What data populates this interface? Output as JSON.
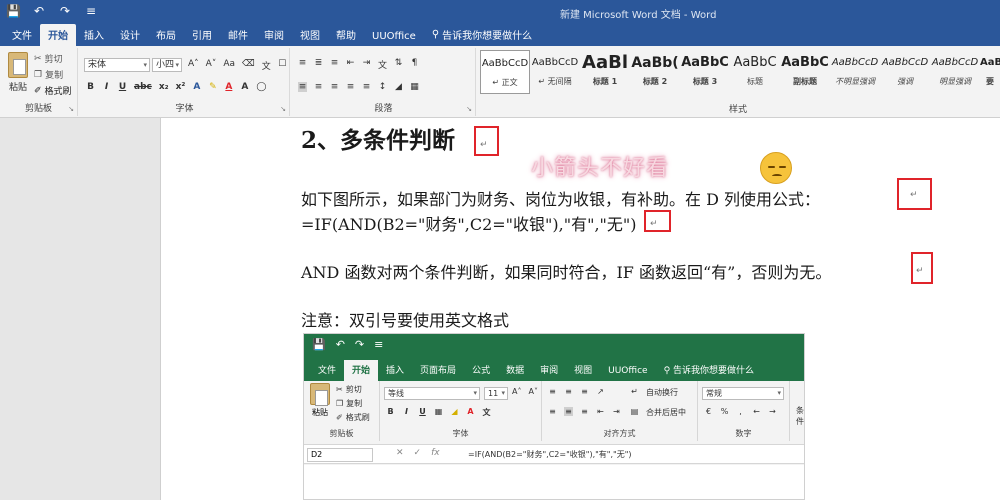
{
  "word": {
    "window_title": "新建 Microsoft Word 文档 - Word",
    "qat_icons": [
      "save-icon",
      "undo-icon",
      "redo-icon",
      "customize-icon"
    ],
    "tabs": [
      {
        "label": "文件"
      },
      {
        "label": "开始",
        "active": true
      },
      {
        "label": "插入"
      },
      {
        "label": "设计"
      },
      {
        "label": "布局"
      },
      {
        "label": "引用"
      },
      {
        "label": "邮件"
      },
      {
        "label": "审阅"
      },
      {
        "label": "视图"
      },
      {
        "label": "帮助"
      },
      {
        "label": "UUOffice"
      }
    ],
    "tell_me": "告诉我你想要做什么",
    "clipboard": {
      "paste": "粘贴",
      "cut": "剪切",
      "copy": "复制",
      "format_painter": "格式刷",
      "group": "剪贴板"
    },
    "font": {
      "name": "宋体",
      "size": "小四",
      "group": "字体"
    },
    "paragraph": {
      "group": "段落"
    },
    "styles": {
      "group": "样式",
      "items": [
        {
          "preview": "AaBbCcD",
          "name": "↵ 正文"
        },
        {
          "preview": "AaBbCcD",
          "name": "↵ 无间隔"
        },
        {
          "preview": "AaBl",
          "name": "标题 1"
        },
        {
          "preview": "AaBb(",
          "name": "标题 2"
        },
        {
          "preview": "AaBbC",
          "name": "标题 3"
        },
        {
          "preview": "AaBbC",
          "name": "标题"
        },
        {
          "preview": "AaBbC",
          "name": "副标题"
        },
        {
          "preview": "AaBbCcD",
          "name": "不明显强调"
        },
        {
          "preview": "AaBbCcD",
          "name": "强调"
        },
        {
          "preview": "AaBbCcD",
          "name": "明显强调"
        },
        {
          "preview": "AaB",
          "name": "要"
        }
      ]
    }
  },
  "document": {
    "heading": "2、多条件判断",
    "p1": "如下图所示，如果部门为财务、岗位为收银，有补助。在 D 列使用公式：",
    "p2": "=IF(AND(B2=\"财务\",C2=\"收银\"),\"有\",\"无\")",
    "p3": "AND 函数对两个条件判断，如果同时符合，IF 函数返回“有”，否则为无。",
    "p4": "注意：双引号要使用英文格式",
    "return_mark": "↵",
    "overlay_text": "小箭头不好看"
  },
  "excel": {
    "tabs": [
      {
        "label": "文件"
      },
      {
        "label": "开始",
        "active": true
      },
      {
        "label": "插入"
      },
      {
        "label": "页面布局"
      },
      {
        "label": "公式"
      },
      {
        "label": "数据"
      },
      {
        "label": "审阅"
      },
      {
        "label": "视图"
      },
      {
        "label": "UUOffice"
      }
    ],
    "tell_me": "告诉我你想要做什么",
    "clipboard": {
      "paste": "粘贴",
      "cut": "剪切",
      "copy": "复制",
      "format_painter": "格式刷",
      "group": "剪贴板"
    },
    "font": {
      "name": "等线",
      "size": "11",
      "group": "字体"
    },
    "alignment": {
      "wrap": "自动换行",
      "merge": "合并后居中",
      "group": "对齐方式"
    },
    "number": {
      "format": "常规",
      "group": "数字"
    },
    "styles_partial": "条件",
    "name_box": "D2",
    "formula": "=IF(AND(B2=\"财务\",C2=\"收银\"),\"有\",\"无\")"
  },
  "colors": {
    "word_blue": "#2b579a",
    "excel_green": "#217346",
    "annotation_red": "#e0242a"
  }
}
